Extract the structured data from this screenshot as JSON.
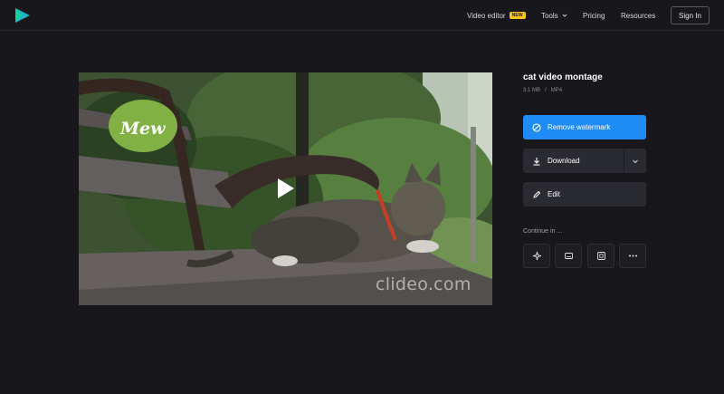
{
  "header": {
    "nav": [
      {
        "label": "Video editor",
        "badge": "NEW"
      },
      {
        "label": "Tools"
      },
      {
        "label": "Pricing"
      },
      {
        "label": "Resources"
      }
    ],
    "signin_label": "Sign In",
    "brand_color": "#1fb5c4"
  },
  "video": {
    "logo_text": "Mew",
    "watermark_text": "clideo.com"
  },
  "file": {
    "title": "cat video montage",
    "size": "3.1 MB",
    "separator": "/",
    "format": "MP4"
  },
  "actions": {
    "remove_watermark_label": "Remove watermark",
    "download_label": "Download",
    "edit_label": "Edit",
    "primary_color": "#1f8bf5"
  },
  "continue": {
    "label": "Continue in ...",
    "tools": [
      "sparkle-icon",
      "subtitles-icon",
      "crop-icon",
      "more-icon"
    ]
  }
}
